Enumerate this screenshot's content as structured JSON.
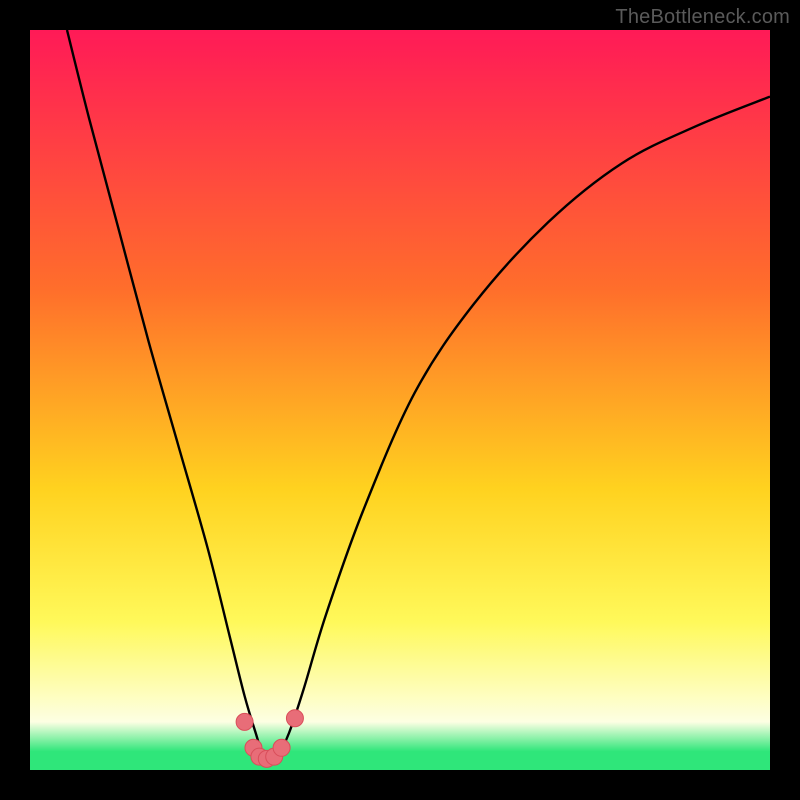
{
  "watermark": "TheBottleneck.com",
  "colors": {
    "frame": "#000000",
    "grad_top": "#ff1a57",
    "grad_mid_upper": "#ff6e2b",
    "grad_mid": "#ffd21f",
    "grad_lower": "#fff95a",
    "grad_pale": "#fdffe3",
    "grad_green": "#2fe67a",
    "curve": "#000000",
    "marker_fill": "#e86d78",
    "marker_stroke": "#d94e5a"
  },
  "chart_data": {
    "type": "line",
    "title": "",
    "xlabel": "",
    "ylabel": "",
    "xlim": [
      0,
      100
    ],
    "ylim": [
      0,
      100
    ],
    "series": [
      {
        "name": "bottleneck-curve",
        "x": [
          5,
          8,
          12,
          16,
          20,
          24,
          27,
          29,
          30.5,
          31.5,
          32.5,
          33.5,
          35,
          37,
          40,
          45,
          52,
          60,
          70,
          80,
          90,
          100
        ],
        "y": [
          100,
          88,
          73,
          58,
          44,
          30,
          18,
          10,
          5,
          2,
          1.5,
          2,
          5,
          11,
          21,
          35,
          51,
          63,
          74,
          82,
          87,
          91
        ]
      }
    ],
    "markers": {
      "name": "highlight-points",
      "x": [
        29,
        30.2,
        31,
        32,
        33,
        34,
        35.8
      ],
      "y": [
        6.5,
        3,
        1.8,
        1.5,
        1.8,
        3,
        7
      ]
    },
    "gradient_stops": [
      {
        "offset": 0.0,
        "key": "grad_top"
      },
      {
        "offset": 0.35,
        "key": "grad_mid_upper"
      },
      {
        "offset": 0.62,
        "key": "grad_mid"
      },
      {
        "offset": 0.8,
        "key": "grad_lower"
      },
      {
        "offset": 0.935,
        "key": "grad_pale"
      },
      {
        "offset": 0.975,
        "key": "grad_green"
      },
      {
        "offset": 1.0,
        "key": "grad_green"
      }
    ],
    "minimum_x": 32
  }
}
